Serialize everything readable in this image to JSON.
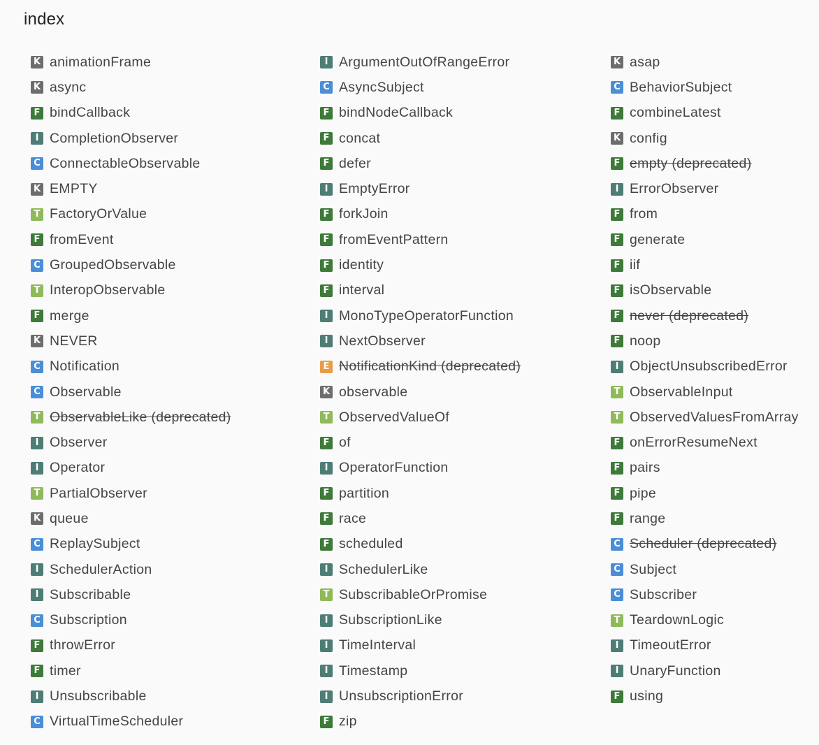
{
  "page": {
    "title": "index"
  },
  "badge_colors": {
    "K": "#6d6d6d",
    "I": "#4e7d76",
    "F": "#3e7a3a",
    "C": "#4a8ed8",
    "T": "#8fba5a",
    "E": "#e99c47"
  },
  "columns": [
    [
      {
        "kind": "K",
        "name": "animationFrame",
        "deprecated": false
      },
      {
        "kind": "K",
        "name": "async",
        "deprecated": false
      },
      {
        "kind": "F",
        "name": "bindCallback",
        "deprecated": false
      },
      {
        "kind": "I",
        "name": "CompletionObserver",
        "deprecated": false
      },
      {
        "kind": "C",
        "name": "ConnectableObservable",
        "deprecated": false
      },
      {
        "kind": "K",
        "name": "EMPTY",
        "deprecated": false
      },
      {
        "kind": "T",
        "name": "FactoryOrValue",
        "deprecated": false
      },
      {
        "kind": "F",
        "name": "fromEvent",
        "deprecated": false
      },
      {
        "kind": "C",
        "name": "GroupedObservable",
        "deprecated": false
      },
      {
        "kind": "T",
        "name": "InteropObservable",
        "deprecated": false
      },
      {
        "kind": "F",
        "name": "merge",
        "deprecated": false
      },
      {
        "kind": "K",
        "name": "NEVER",
        "deprecated": false
      },
      {
        "kind": "C",
        "name": "Notification",
        "deprecated": false
      },
      {
        "kind": "C",
        "name": "Observable",
        "deprecated": false
      },
      {
        "kind": "T",
        "name": "ObservableLike (deprecated)",
        "deprecated": true
      },
      {
        "kind": "I",
        "name": "Observer",
        "deprecated": false
      },
      {
        "kind": "I",
        "name": "Operator",
        "deprecated": false
      },
      {
        "kind": "T",
        "name": "PartialObserver",
        "deprecated": false
      },
      {
        "kind": "K",
        "name": "queue",
        "deprecated": false
      },
      {
        "kind": "C",
        "name": "ReplaySubject",
        "deprecated": false
      },
      {
        "kind": "I",
        "name": "SchedulerAction",
        "deprecated": false
      },
      {
        "kind": "I",
        "name": "Subscribable",
        "deprecated": false
      },
      {
        "kind": "C",
        "name": "Subscription",
        "deprecated": false
      },
      {
        "kind": "F",
        "name": "throwError",
        "deprecated": false
      },
      {
        "kind": "F",
        "name": "timer",
        "deprecated": false
      },
      {
        "kind": "I",
        "name": "Unsubscribable",
        "deprecated": false
      },
      {
        "kind": "C",
        "name": "VirtualTimeScheduler",
        "deprecated": false
      }
    ],
    [
      {
        "kind": "I",
        "name": "ArgumentOutOfRangeError",
        "deprecated": false
      },
      {
        "kind": "C",
        "name": "AsyncSubject",
        "deprecated": false
      },
      {
        "kind": "F",
        "name": "bindNodeCallback",
        "deprecated": false
      },
      {
        "kind": "F",
        "name": "concat",
        "deprecated": false
      },
      {
        "kind": "F",
        "name": "defer",
        "deprecated": false
      },
      {
        "kind": "I",
        "name": "EmptyError",
        "deprecated": false
      },
      {
        "kind": "F",
        "name": "forkJoin",
        "deprecated": false
      },
      {
        "kind": "F",
        "name": "fromEventPattern",
        "deprecated": false
      },
      {
        "kind": "F",
        "name": "identity",
        "deprecated": false
      },
      {
        "kind": "F",
        "name": "interval",
        "deprecated": false
      },
      {
        "kind": "I",
        "name": "MonoTypeOperatorFunction",
        "deprecated": false
      },
      {
        "kind": "I",
        "name": "NextObserver",
        "deprecated": false
      },
      {
        "kind": "E",
        "name": "NotificationKind (deprecated)",
        "deprecated": true
      },
      {
        "kind": "K",
        "name": "observable",
        "deprecated": false
      },
      {
        "kind": "T",
        "name": "ObservedValueOf",
        "deprecated": false
      },
      {
        "kind": "F",
        "name": "of",
        "deprecated": false
      },
      {
        "kind": "I",
        "name": "OperatorFunction",
        "deprecated": false
      },
      {
        "kind": "F",
        "name": "partition",
        "deprecated": false
      },
      {
        "kind": "F",
        "name": "race",
        "deprecated": false
      },
      {
        "kind": "F",
        "name": "scheduled",
        "deprecated": false
      },
      {
        "kind": "I",
        "name": "SchedulerLike",
        "deprecated": false
      },
      {
        "kind": "T",
        "name": "SubscribableOrPromise",
        "deprecated": false
      },
      {
        "kind": "I",
        "name": "SubscriptionLike",
        "deprecated": false
      },
      {
        "kind": "I",
        "name": "TimeInterval",
        "deprecated": false
      },
      {
        "kind": "I",
        "name": "Timestamp",
        "deprecated": false
      },
      {
        "kind": "I",
        "name": "UnsubscriptionError",
        "deprecated": false
      },
      {
        "kind": "F",
        "name": "zip",
        "deprecated": false
      }
    ],
    [
      {
        "kind": "K",
        "name": "asap",
        "deprecated": false
      },
      {
        "kind": "C",
        "name": "BehaviorSubject",
        "deprecated": false
      },
      {
        "kind": "F",
        "name": "combineLatest",
        "deprecated": false
      },
      {
        "kind": "K",
        "name": "config",
        "deprecated": false
      },
      {
        "kind": "F",
        "name": "empty (deprecated)",
        "deprecated": true
      },
      {
        "kind": "I",
        "name": "ErrorObserver",
        "deprecated": false
      },
      {
        "kind": "F",
        "name": "from",
        "deprecated": false
      },
      {
        "kind": "F",
        "name": "generate",
        "deprecated": false
      },
      {
        "kind": "F",
        "name": "iif",
        "deprecated": false
      },
      {
        "kind": "F",
        "name": "isObservable",
        "deprecated": false
      },
      {
        "kind": "F",
        "name": "never (deprecated)",
        "deprecated": true
      },
      {
        "kind": "F",
        "name": "noop",
        "deprecated": false
      },
      {
        "kind": "I",
        "name": "ObjectUnsubscribedError",
        "deprecated": false
      },
      {
        "kind": "T",
        "name": "ObservableInput",
        "deprecated": false
      },
      {
        "kind": "T",
        "name": "ObservedValuesFromArray",
        "deprecated": false
      },
      {
        "kind": "F",
        "name": "onErrorResumeNext",
        "deprecated": false
      },
      {
        "kind": "F",
        "name": "pairs",
        "deprecated": false
      },
      {
        "kind": "F",
        "name": "pipe",
        "deprecated": false
      },
      {
        "kind": "F",
        "name": "range",
        "deprecated": false
      },
      {
        "kind": "C",
        "name": "Scheduler (deprecated)",
        "deprecated": true
      },
      {
        "kind": "C",
        "name": "Subject",
        "deprecated": false
      },
      {
        "kind": "C",
        "name": "Subscriber",
        "deprecated": false
      },
      {
        "kind": "T",
        "name": "TeardownLogic",
        "deprecated": false
      },
      {
        "kind": "I",
        "name": "TimeoutError",
        "deprecated": false
      },
      {
        "kind": "I",
        "name": "UnaryFunction",
        "deprecated": false
      },
      {
        "kind": "F",
        "name": "using",
        "deprecated": false
      }
    ]
  ]
}
